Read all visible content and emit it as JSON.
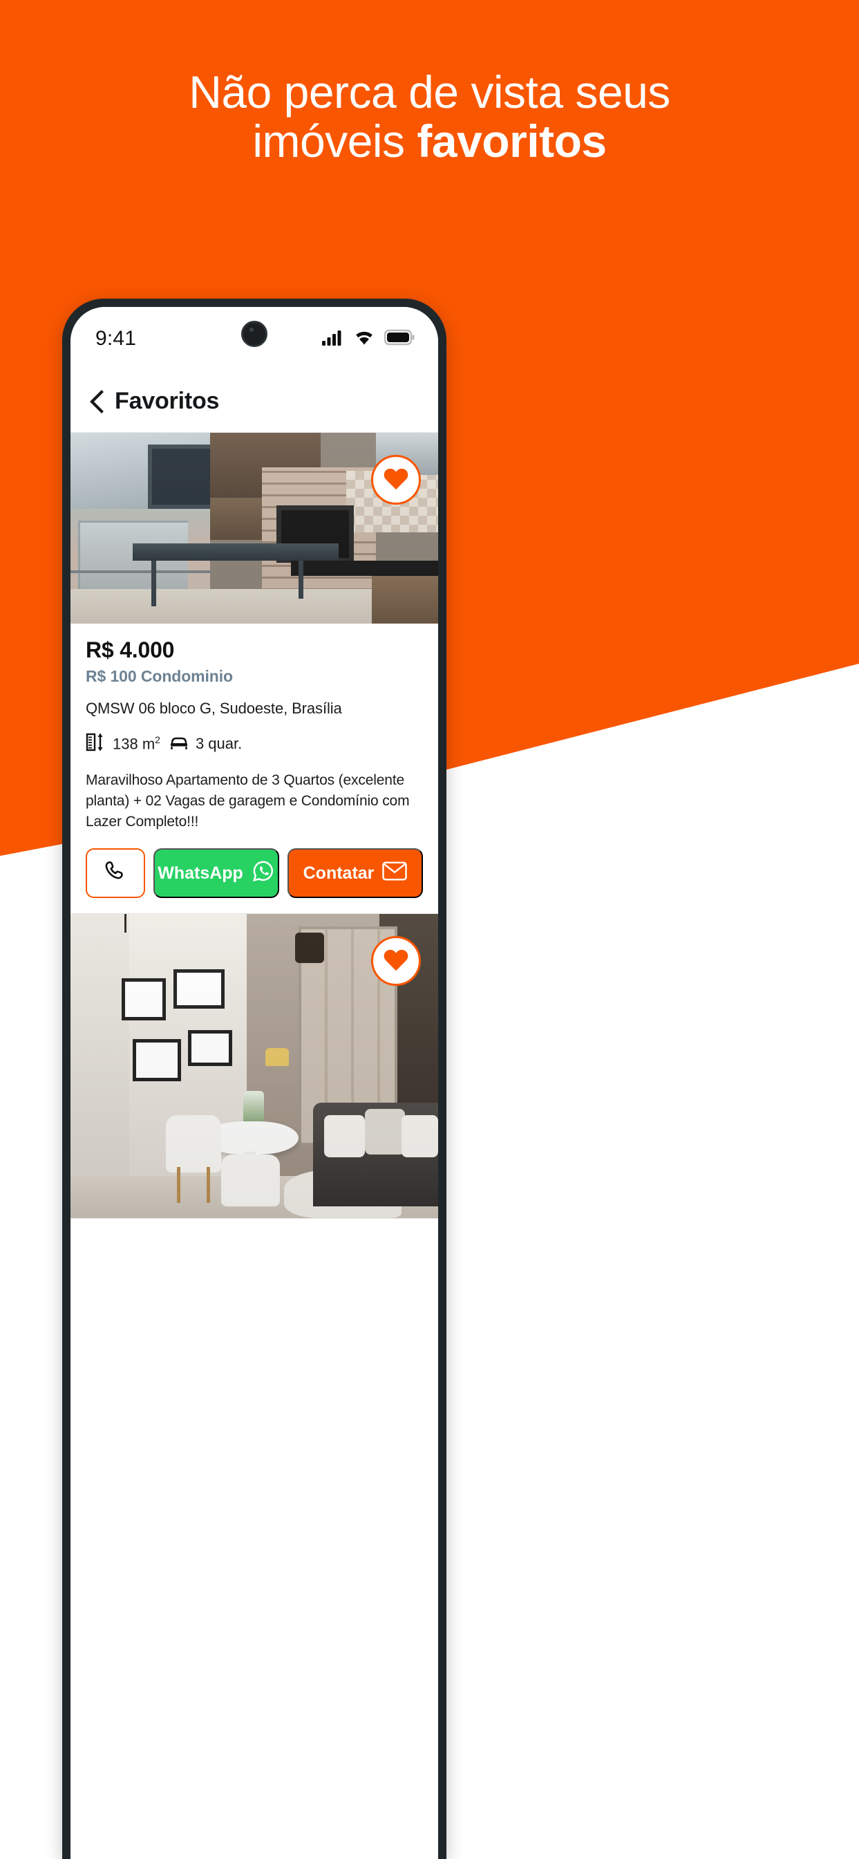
{
  "promo": {
    "headline_line1": "Não perca de vista seus",
    "headline_line2_normal": "imóveis ",
    "headline_line2_bold": "favoritos",
    "background_color": "#f95601"
  },
  "phone": {
    "status_bar": {
      "time": "9:41",
      "icons": [
        "cellular-signal-icon",
        "wifi-icon",
        "battery-icon"
      ]
    },
    "nav": {
      "back_icon": "chevron-left-icon",
      "title": "Favoritos"
    }
  },
  "listings": [
    {
      "favorite_icon": "heart-icon",
      "favorited": true,
      "price": "R$ 4.000",
      "condo_fee": "R$ 100 Condominio",
      "address": "QMSW 06 bloco G, Sudoeste, Brasília",
      "features": [
        {
          "icon": "ruler-area-icon",
          "value": "138 m",
          "unit": "2"
        },
        {
          "icon": "bed-icon",
          "value": "3 quar."
        }
      ],
      "description": "Maravilhoso Apartamento de 3 Quartos (excelente planta) + 02 Vagas de garagem e Condomínio com Lazer Completo!!!",
      "actions": {
        "phone_label": "",
        "phone_icon": "phone-icon",
        "whatsapp_label": "WhatsApp",
        "whatsapp_icon": "whatsapp-icon",
        "contact_label": "Contatar",
        "contact_icon": "envelope-icon"
      }
    },
    {
      "favorite_icon": "heart-icon",
      "favorited": true
    }
  ],
  "colors": {
    "brand_orange": "#f95601",
    "whatsapp_green": "#27d263",
    "condo_slate": "#6d8293"
  }
}
